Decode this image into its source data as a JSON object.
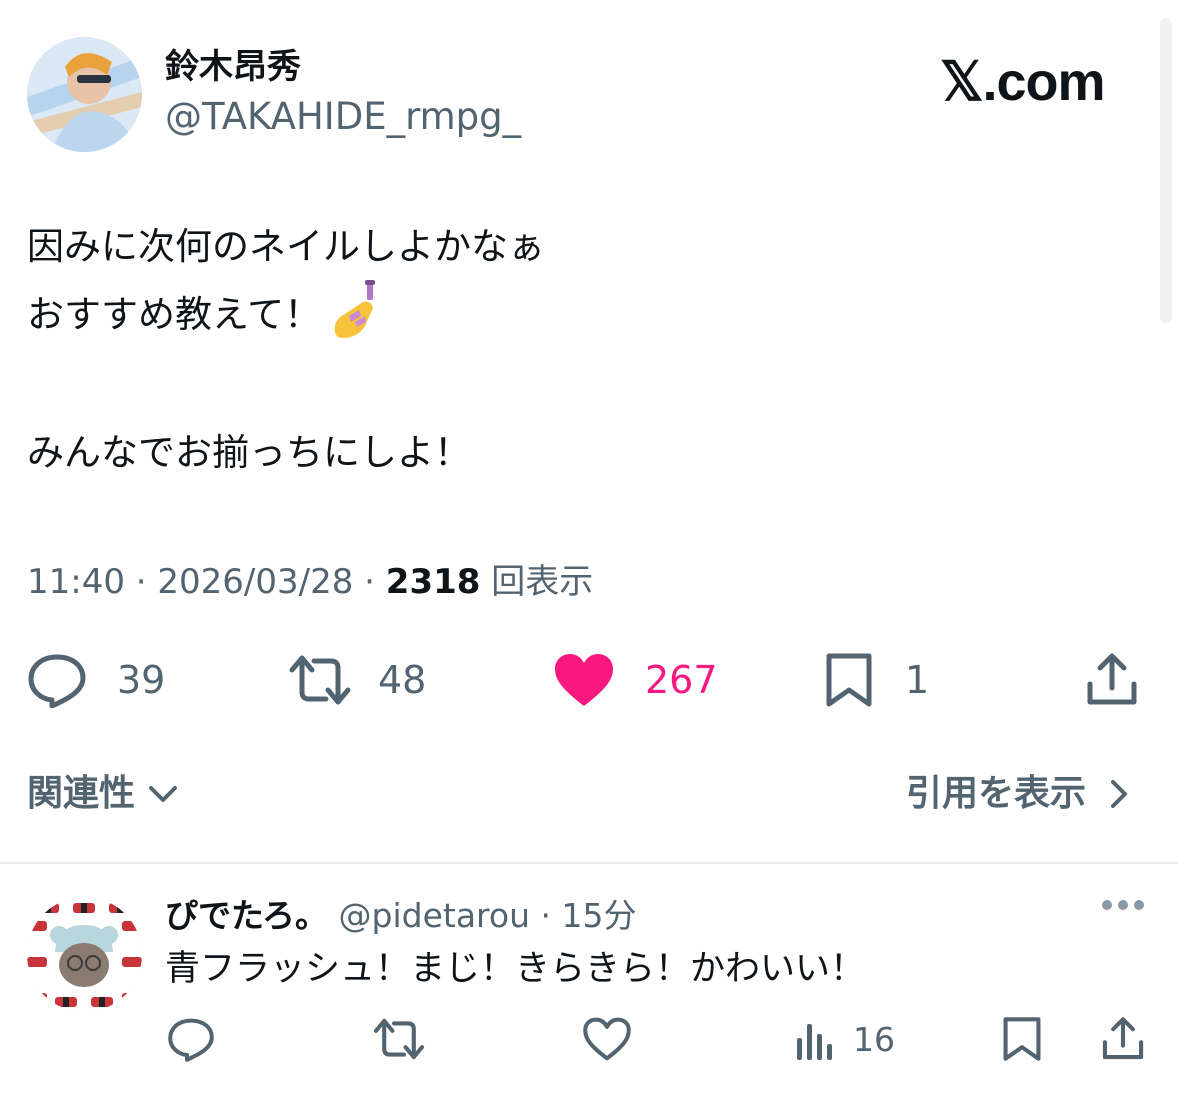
{
  "header": {
    "author_name": "鈴木昂秀",
    "author_handle": "@TAKAHIDE_rmpg_",
    "logo_text": "𝕏.com"
  },
  "tweet": {
    "line1": "因みに次何のネイルしよかなぁ",
    "line2": "おすすめ教えて！",
    "line3": "みんなでお揃っちにしよ！",
    "nail_emoji": "nail-polish-emoji"
  },
  "meta": {
    "time_date": "11:40 · 2026/03/28 · ",
    "views_count": "2318",
    "views_label": "回表示"
  },
  "actions": {
    "replies": "39",
    "retweets": "48",
    "likes": "267",
    "bookmarks": "1",
    "liked_color": "#f91880"
  },
  "filters": {
    "relevance_label": "関連性",
    "quotes_label": "引用を表示"
  },
  "reply": {
    "name": "ぴでたろ。",
    "handle": "@pidetarou",
    "separator": " · ",
    "time": "15分",
    "text": "青フラッシュ！まじ！きらきら！かわいい！",
    "views": "16"
  },
  "colors": {
    "text": "#0f1419",
    "secondary": "#536471",
    "like": "#f91880",
    "divider": "#e7e9ea"
  }
}
